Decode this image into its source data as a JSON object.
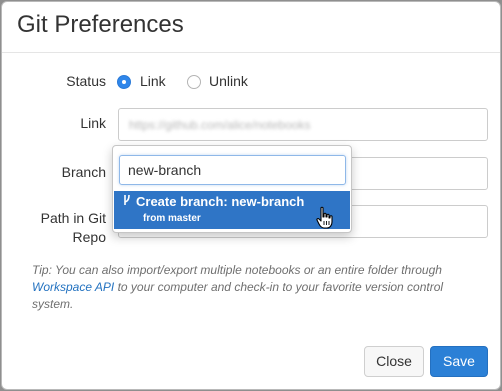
{
  "dialog": {
    "title": "Git Preferences"
  },
  "form": {
    "status_label": "Status",
    "status_options": [
      {
        "label": "Link",
        "selected": true
      },
      {
        "label": "Unlink",
        "selected": false
      }
    ],
    "link_label": "Link",
    "link_value_blurred": "https://github.com/alice/notebooks",
    "branch_label": "Branch",
    "path_label_line1": "Path in Git",
    "path_label_line2": "Repo"
  },
  "branch_dropdown": {
    "input_value": "new-branch",
    "option_main": "Create branch: new-branch",
    "option_sub": "from master",
    "option_icon": "git-branch-icon"
  },
  "tip": {
    "prefix": "Tip: You can also import/export multiple notebooks or an entire folder through ",
    "link_text": "Workspace API",
    "suffix": " to your computer and check-in to your favorite version control system."
  },
  "footer": {
    "close_label": "Close",
    "save_label": "Save"
  },
  "colors": {
    "accent": "#2b80d6",
    "highlight": "#2f75c6",
    "link": "#2372c0"
  }
}
